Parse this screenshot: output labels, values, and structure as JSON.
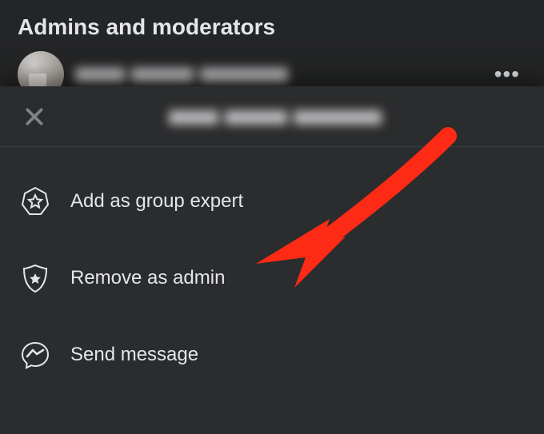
{
  "header": {
    "title": "Admins and moderators"
  },
  "member": {
    "name_blurred": true,
    "more_label": "•••"
  },
  "sheet": {
    "close_label": "Close",
    "name_blurred": true,
    "items": [
      {
        "id": "add-expert",
        "label": "Add as group expert",
        "icon": "star-hex-icon"
      },
      {
        "id": "remove-admin",
        "label": "Remove as admin",
        "icon": "shield-star-icon"
      },
      {
        "id": "send-message",
        "label": "Send message",
        "icon": "messenger-icon"
      }
    ]
  },
  "annotation": {
    "arrow_color": "#fd2a16",
    "target": "remove-admin"
  }
}
